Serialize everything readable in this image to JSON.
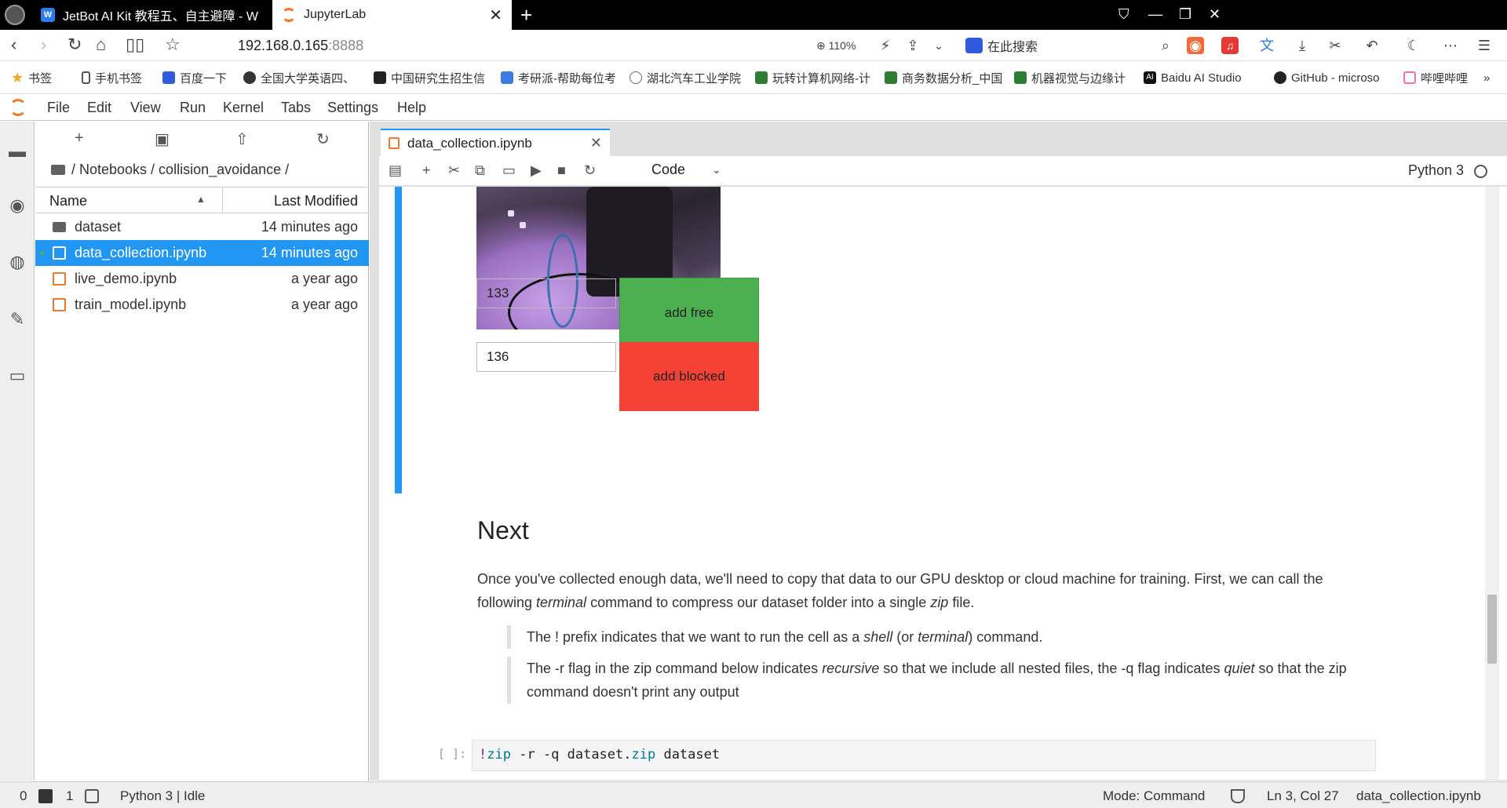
{
  "browser": {
    "tabs": [
      {
        "label": "JetBot AI Kit 教程五、自主避障 - W",
        "active": false
      },
      {
        "label": "JupyterLab",
        "active": true
      }
    ],
    "new_tab": "+",
    "address": "192.168.0.165",
    "address_port": ":8888",
    "zoom": "110%",
    "search_placeholder": "在此搜索"
  },
  "bookmarks": [
    {
      "label": "书签",
      "icon": "star-icon"
    },
    {
      "label": "手机书签",
      "icon": "phone-icon"
    },
    {
      "label": "百度一下",
      "icon": "baidu-icon"
    },
    {
      "label": "全国大学英语四、",
      "icon": "globe-icon"
    },
    {
      "label": "中国研究生招生信",
      "icon": "graduation-icon"
    },
    {
      "label": "考研派-帮助每位考",
      "icon": "kaoyan-icon"
    },
    {
      "label": "湖北汽车工业学院",
      "icon": "globe-icon"
    },
    {
      "label": "玩转计算机网络-计",
      "icon": "book-icon"
    },
    {
      "label": "商务数据分析_中国",
      "icon": "book-icon"
    },
    {
      "label": "机器视觉与边缘计",
      "icon": "book-icon"
    },
    {
      "label": "Baidu AI Studio",
      "icon": "ai-icon"
    },
    {
      "label": "GitHub - microso",
      "icon": "github-icon"
    },
    {
      "label": "哔哩哔哩",
      "icon": "bilibili-icon"
    }
  ],
  "menu": [
    "File",
    "Edit",
    "View",
    "Run",
    "Kernel",
    "Tabs",
    "Settings",
    "Help"
  ],
  "filebrowser": {
    "breadcrumb": "/ Notebooks / collision_avoidance /",
    "col_name": "Name",
    "col_modified": "Last Modified",
    "files": [
      {
        "name": "dataset",
        "modified": "14 minutes ago",
        "type": "folder",
        "selected": false
      },
      {
        "name": "data_collection.ipynb",
        "modified": "14 minutes ago",
        "type": "notebook",
        "selected": true
      },
      {
        "name": "live_demo.ipynb",
        "modified": "a year ago",
        "type": "notebook",
        "selected": false
      },
      {
        "name": "train_model.ipynb",
        "modified": "a year ago",
        "type": "notebook",
        "selected": false
      }
    ]
  },
  "notebook": {
    "tab_label": "data_collection.ipynb",
    "cell_type": "Code",
    "kernel": "Python 3",
    "free_count": "133",
    "blocked_count": "136",
    "free_label": "add free",
    "blocked_label": "add blocked",
    "heading": "Next",
    "para_part1": "Once you've collected enough data, we'll need to copy that data to our GPU desktop or cloud machine for training. First, we can call the following ",
    "para_em1": "terminal",
    "para_part2": " command to compress our dataset folder into a single ",
    "para_em2": "zip",
    "para_part3": " file.",
    "quote1_a": "The ! prefix indicates that we want to run the cell as a ",
    "quote1_em1": "shell",
    "quote1_b": " (or ",
    "quote1_em2": "terminal",
    "quote1_c": ") command.",
    "quote2_a": "The -r flag in the zip command below indicates ",
    "quote2_em1": "recursive",
    "quote2_b": " so that we include all nested files, the -q flag indicates ",
    "quote2_em2": "quiet",
    "quote2_c": " so that the zip command doesn't print any output",
    "code_prompt": "[ ]:",
    "code_bang": "!",
    "code_zip": "zip",
    "code_args1": " -r -q dataset.",
    "code_ext": "zip",
    "code_args2": " dataset"
  },
  "statusbar": {
    "terminals": "0",
    "kernels": "1",
    "kernel_status": "Python 3 | Idle",
    "mode": "Mode: Command",
    "position": "Ln 3, Col 27",
    "file": "data_collection.ipynb"
  },
  "colors": {
    "accent": "#2196f3",
    "jupyter_orange": "#f37726",
    "free_green": "#4caf50",
    "blocked_red": "#f44336"
  }
}
